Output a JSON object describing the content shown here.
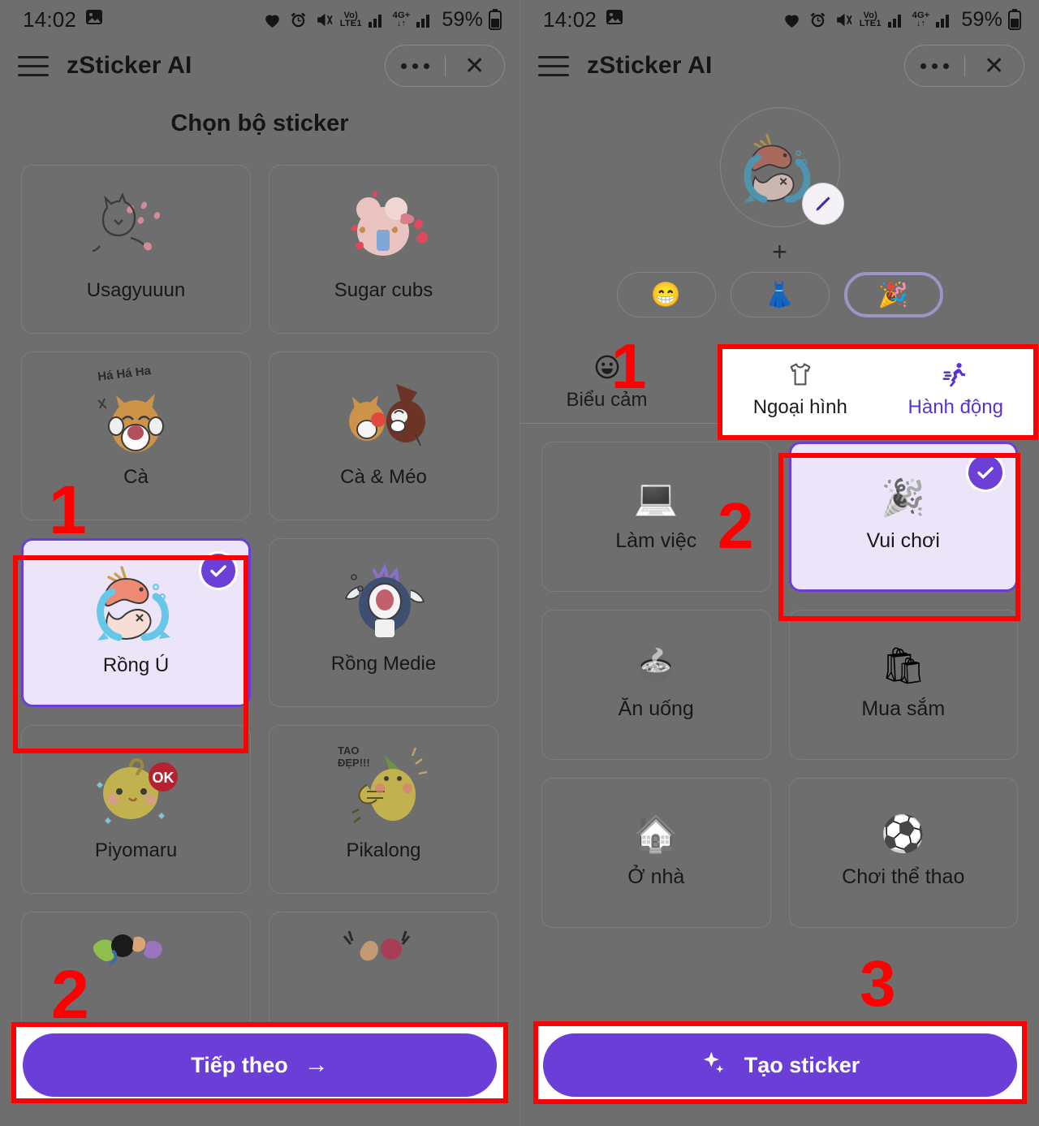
{
  "status_bar": {
    "time": "14:02",
    "screenshot_icon": "image-icon",
    "icons": [
      "heart-icon",
      "alarm-icon",
      "mute-icon"
    ],
    "volte_label_top": "Vo)",
    "volte_label_bottom": "LTE1",
    "network_label": "4G+",
    "battery_percent": "59%"
  },
  "app": {
    "title": "zSticker AI",
    "menu_icon": "hamburger-icon",
    "more_icon": "more-dots-icon",
    "close_icon": "close-icon"
  },
  "left_screen": {
    "page_title": "Chọn bộ sticker",
    "sticker_sets": [
      {
        "name": "Usagyuuun",
        "selected": false
      },
      {
        "name": "Sugar cubs",
        "selected": false
      },
      {
        "name": "Cà",
        "selected": false
      },
      {
        "name": "Cà & Méo",
        "selected": false
      },
      {
        "name": "Rồng Ú",
        "selected": true
      },
      {
        "name": "Rồng Medie",
        "selected": false
      },
      {
        "name": "Piyomaru",
        "selected": false
      },
      {
        "name": "Pikalong",
        "selected": false
      },
      {
        "name": "",
        "selected": false
      },
      {
        "name": "",
        "selected": false
      }
    ],
    "cta": {
      "label": "Tiếp theo",
      "arrow": "→",
      "icon": "arrow-right-icon"
    },
    "annotations": [
      {
        "number": "1",
        "target": "sticker-set-ca"
      },
      {
        "number": "2",
        "target": "next-button"
      }
    ]
  },
  "right_screen": {
    "avatar": {
      "icon": "dragon-sticker-avatar",
      "edit_icon": "pencil-icon"
    },
    "plus": "+",
    "chips": [
      {
        "icon": "grinning-face-emoji",
        "glyph": "😁",
        "active": false
      },
      {
        "icon": "dress-emoji",
        "glyph": "👗",
        "active": false
      },
      {
        "icon": "party-popper-emoji",
        "glyph": "🎉",
        "active": true
      }
    ],
    "tabs": [
      {
        "label": "Biểu cảm",
        "icon": "smiley-face-icon",
        "active": false
      },
      {
        "label": "Ngoại hình",
        "icon": "tshirt-icon",
        "active": false
      },
      {
        "label": "Hành động",
        "icon": "running-person-icon",
        "active": true
      }
    ],
    "options": [
      {
        "label": "Làm việc",
        "icon": "laptop-emoji",
        "glyph": "💻",
        "selected": false
      },
      {
        "label": "Vui chơi",
        "icon": "party-popper-emoji",
        "glyph": "🎉",
        "selected": true
      },
      {
        "label": "Ăn uống",
        "icon": "cooking-pot-emoji",
        "glyph": "🍲",
        "selected": false
      },
      {
        "label": "Mua sắm",
        "icon": "shopping-bags-emoji",
        "glyph": "🛍",
        "selected": false
      },
      {
        "label": "Ở nhà",
        "icon": "house-emoji",
        "glyph": "🏠",
        "selected": false
      },
      {
        "label": "Chơi thể thao",
        "icon": "soccer-ball-emoji",
        "glyph": "⚽",
        "selected": false
      }
    ],
    "cta": {
      "label": "Tạo sticker",
      "icon": "sparkles-icon"
    },
    "annotations": [
      {
        "number": "1",
        "target": "tab-group"
      },
      {
        "number": "2",
        "target": "option-vui-choi"
      },
      {
        "number": "3",
        "target": "create-sticker-button"
      }
    ]
  },
  "colors": {
    "accent_purple": "#6C3ED8",
    "selected_bg": "#ECE5FA",
    "annotation_red": "#FE0000",
    "overlay_gray": "#6E6E6E"
  }
}
